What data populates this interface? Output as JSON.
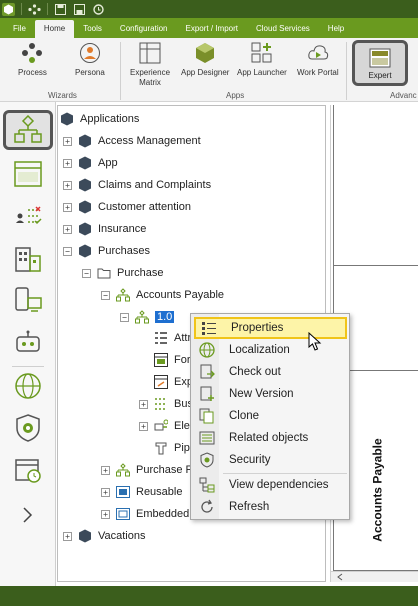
{
  "titlebar": {
    "icons": [
      "app-logo-icon",
      "network-icon",
      "save-icon",
      "save-as-icon",
      "refresh-icon"
    ]
  },
  "menu": [
    "File",
    "Home",
    "Tools",
    "Configuration",
    "Export / Import",
    "Cloud Services",
    "Help"
  ],
  "menu_active": "Home",
  "ribbon": {
    "buttons": [
      {
        "label": "Process",
        "icon": "process-icon"
      },
      {
        "label": "Persona",
        "icon": "persona-icon"
      },
      {
        "label": "Experience\nMatrix",
        "icon": "experience-matrix-icon"
      },
      {
        "label": "App Designer",
        "icon": "app-designer-icon"
      },
      {
        "label": "App Launcher",
        "icon": "app-launcher-icon"
      },
      {
        "label": "Work Portal",
        "icon": "work-portal-icon"
      },
      {
        "label": "Expert",
        "icon": "expert-icon"
      }
    ],
    "groups": [
      "Wizards",
      "Apps",
      "Advanc"
    ]
  },
  "leftnav": [
    "modeler-icon",
    "window-icon",
    "actors-icon",
    "organization-icon",
    "devices-icon",
    "bot-icon",
    "globe-icon",
    "shield-gear-icon",
    "calendar-clock-icon",
    "chevron-right-icon"
  ],
  "tree": {
    "root": "Applications",
    "items": [
      "Access Management",
      "App",
      "Claims and Complaints",
      "Customer attention",
      "Insurance",
      "Purchases",
      "Purchase",
      "Accounts Payable",
      "1.0",
      "Attr",
      "Form",
      "Exp",
      "Busi",
      "Elem",
      "Pipe",
      "Purchase Re",
      "Reusable",
      "Embedded",
      "Vacations"
    ]
  },
  "context_menu": {
    "items": [
      {
        "label": "Properties",
        "icon": "properties-icon"
      },
      {
        "label": "Localization",
        "icon": "globe-icon"
      },
      {
        "label": "Check out",
        "icon": "check-out-icon"
      },
      {
        "label": "New Version",
        "icon": "new-version-icon"
      },
      {
        "label": "Clone",
        "icon": "clone-icon"
      },
      {
        "label": "Related objects",
        "icon": "related-objects-icon"
      },
      {
        "label": "Security",
        "icon": "security-icon"
      },
      {
        "label": "View dependencies",
        "icon": "dependencies-icon"
      },
      {
        "label": "Refresh",
        "icon": "refresh-icon"
      }
    ]
  },
  "canvas": {
    "lane_title": "Accounts Payable"
  },
  "colors": {
    "accent": "#6a9a1f",
    "dark": "#3b5e1c",
    "selection": "#1e6fd0",
    "highlight": "#fdf4a8"
  }
}
